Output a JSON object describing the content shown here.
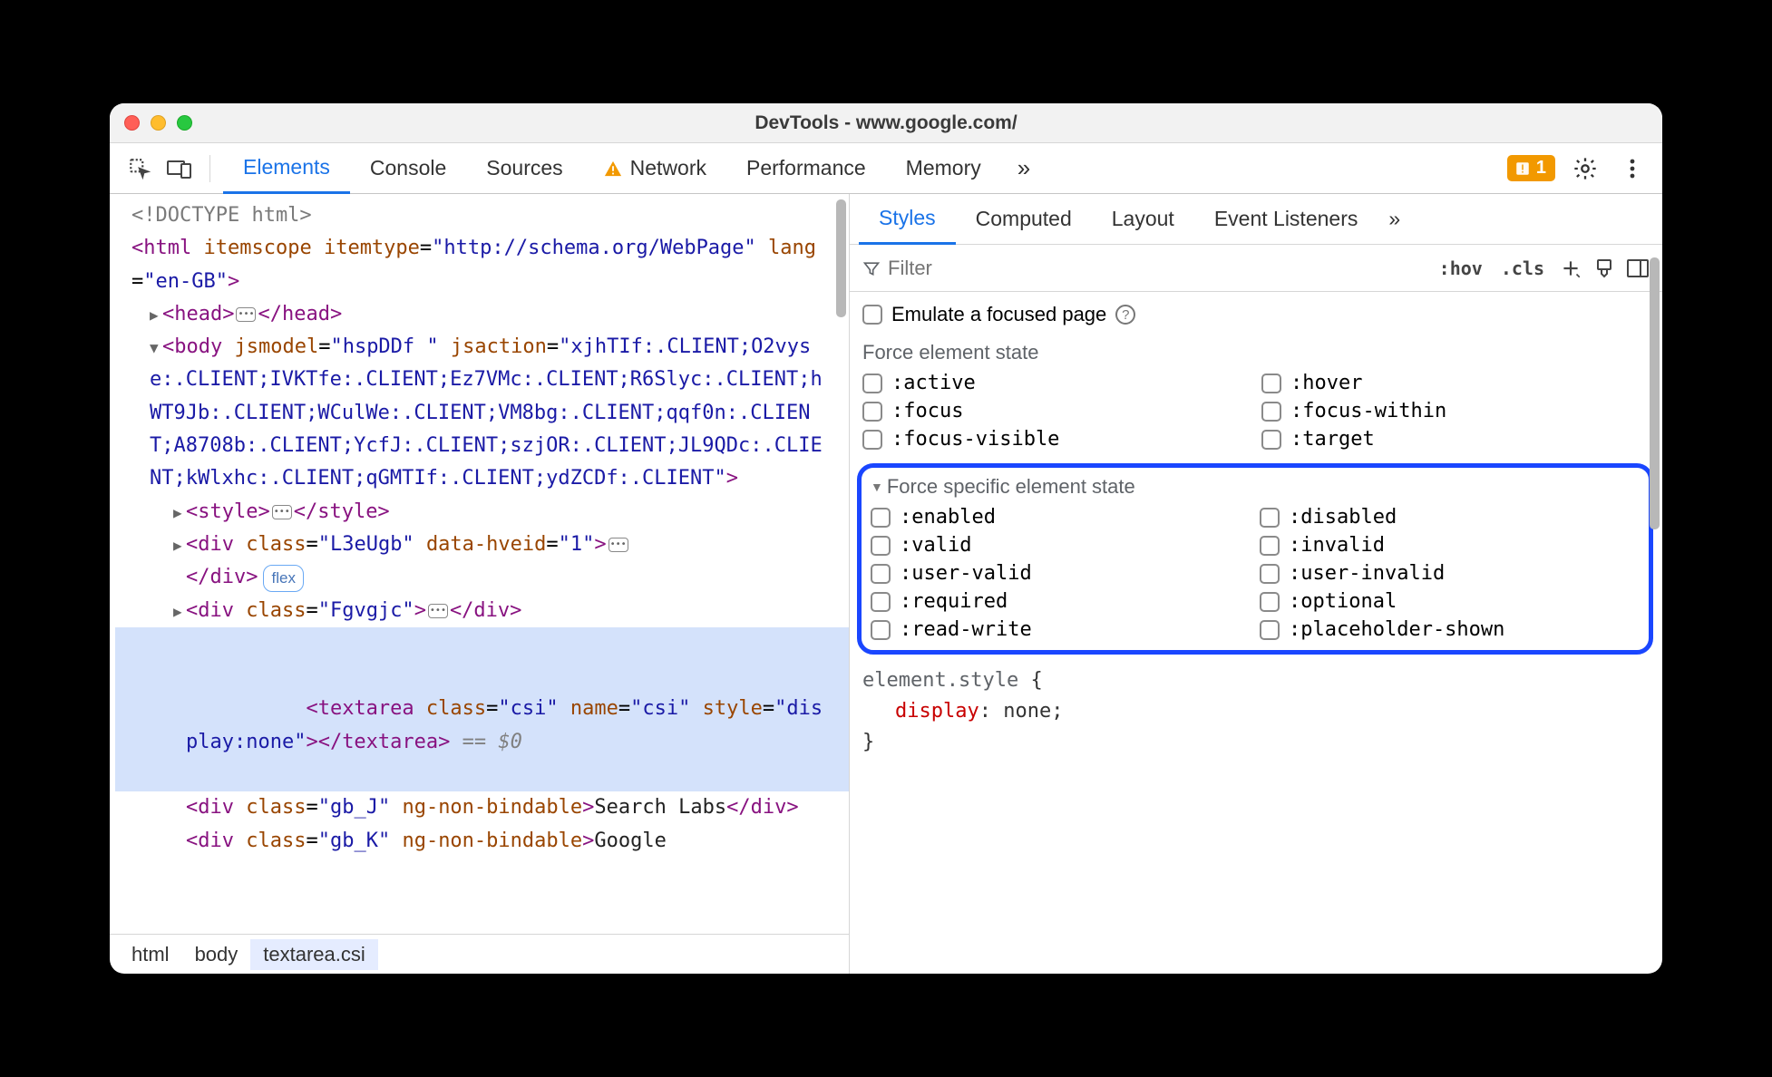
{
  "window": {
    "title": "DevTools - www.google.com/"
  },
  "toolbar": {
    "tabs": [
      {
        "label": "Elements",
        "active": true
      },
      {
        "label": "Console"
      },
      {
        "label": "Sources"
      },
      {
        "label": "Network",
        "warn": true
      },
      {
        "label": "Performance"
      },
      {
        "label": "Memory"
      }
    ],
    "more": "»",
    "warn_count": "1"
  },
  "dom": {
    "doctype": "<!DOCTYPE html>",
    "html_open": "<html itemscope itemtype=\"http://schema.org/WebPage\" lang=\"en-GB\">",
    "head": "<head>…</head>",
    "body_open": "<body jsmodel=\"hspDDf \" jsaction=\"xjhTIf:.CLIENT;O2vyse:.CLIENT;IVKTfe:.CLIENT;Ez7VMc:.CLIENT;R6Slyc:.CLIENT;hWT9Jb:.CLIENT;WCulWe:.CLIENT;VM8bg:.CLIENT;qqf0n:.CLIENT;A8708b:.CLIENT;YcfJ:.CLIENT;szjOR:.CLIENT;JL9QDc:.CLIENT;kWlxhc:.CLIENT;qGMTIf:.CLIENT;ydZCDf:.CLIENT\">",
    "style": "<style>…</style>",
    "div1": "<div class=\"L3eUgb\" data-hveid=\"1\">…</div>",
    "flex_badge": "flex",
    "div2": "<div class=\"Fgvgjc\">…</div>",
    "textarea": "<textarea class=\"csi\" name=\"csi\" style=\"display:none\"></textarea>",
    "zero": " == $0",
    "div_j": "<div class=\"gb_J\" ng-non-bindable>Search Labs</div>",
    "div_k": "<div class=\"gb_K\" ng-non-bindable>Google"
  },
  "breadcrumbs": [
    "html",
    "body",
    "textarea.csi"
  ],
  "styles": {
    "subtabs": [
      {
        "label": "Styles",
        "active": true
      },
      {
        "label": "Computed"
      },
      {
        "label": "Layout"
      },
      {
        "label": "Event Listeners"
      }
    ],
    "more": "»",
    "filter_placeholder": "Filter",
    "hov": ":hov",
    "cls": ".cls",
    "emulate_label": "Emulate a focused page",
    "force_title": "Force element state",
    "states": [
      ":active",
      ":hover",
      ":focus",
      ":focus-within",
      ":focus-visible",
      ":target"
    ],
    "specific_title": "Force specific element state",
    "specific_states": [
      ":enabled",
      ":disabled",
      ":valid",
      ":invalid",
      ":user-valid",
      ":user-invalid",
      ":required",
      ":optional",
      ":read-write",
      ":placeholder-shown"
    ],
    "css_selector": "element.style",
    "css_prop": "display",
    "css_value": "none"
  }
}
